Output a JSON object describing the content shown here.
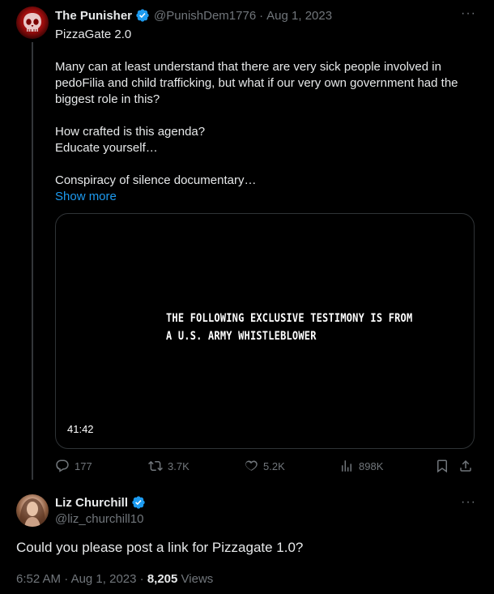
{
  "colors": {
    "background": "#000000",
    "text": "#e7e9ea",
    "muted": "#71767b",
    "link": "#1d9bf0",
    "verified": "#1d9bf0"
  },
  "tweet1": {
    "author_name": "The Punisher",
    "handle": "@PunishDem1776",
    "separator": "·",
    "date": "Aug 1, 2023",
    "more_label": "···",
    "lines": {
      "l1": "PizzaGate 2.0",
      "l2": "Many can at least understand that there are very sick people involved in pedoFilia and child trafficking, but what if our very own government had the biggest role in this?",
      "l3": "How crafted is this agenda?",
      "l4": "Educate yourself…",
      "l5": "Conspiracy of silence documentary…"
    },
    "show_more": "Show more",
    "video": {
      "line1": "THE FOLLOWING EXCLUSIVE TESTIMONY IS FROM",
      "line2": "A U.S. ARMY WHISTLEBLOWER",
      "duration": "41:42"
    },
    "actions": {
      "replies": "177",
      "reposts": "3.7K",
      "likes": "5.2K",
      "views": "898K"
    },
    "icons": [
      "reply-icon",
      "repost-icon",
      "like-icon",
      "views-icon",
      "bookmark-icon",
      "share-icon",
      "verified-icon"
    ]
  },
  "tweet2": {
    "author_name": "Liz Churchill",
    "handle": "@liz_churchill10",
    "more_label": "···",
    "text": "Could you please post a link for Pizzagate 1.0?",
    "time": "6:52 AM",
    "separator": "·",
    "date": "Aug 1, 2023",
    "views_count": "8,205",
    "views_label": "Views"
  }
}
